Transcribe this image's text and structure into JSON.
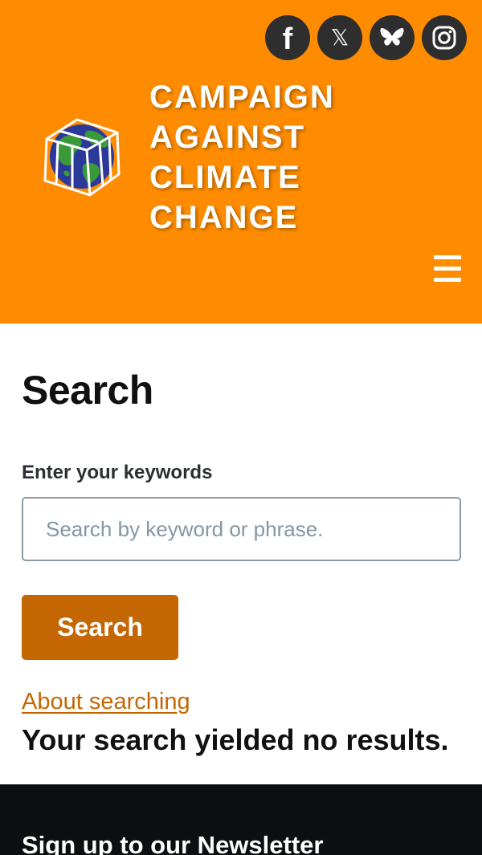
{
  "header": {
    "site_name_lines": [
      "CAMPAIGN",
      "AGAINST",
      "CLIMATE",
      "CHANGE"
    ],
    "logo_icon": "caged-globe-logo",
    "background_color": "#ff8c00",
    "social": [
      {
        "name": "facebook",
        "icon": "facebook-icon",
        "glyph": "f"
      },
      {
        "name": "x",
        "icon": "x-icon",
        "glyph": "𝕏"
      },
      {
        "name": "bluesky",
        "icon": "bluesky-icon",
        "glyph": ""
      },
      {
        "name": "instagram",
        "icon": "instagram-icon",
        "glyph": ""
      }
    ],
    "menu_icon": "hamburger-icon"
  },
  "main": {
    "title": "Search",
    "keywords_label": "Enter your keywords",
    "search_input": {
      "value": "",
      "placeholder": "Search by keyword or phrase."
    },
    "search_button_label": "Search",
    "about_link": "About searching",
    "no_results_text": "Your search yielded no results.",
    "accent_color": "#c46703"
  },
  "footer": {
    "newsletter_title": "Sign up to our Newsletter",
    "background_color": "#0e0f11"
  }
}
